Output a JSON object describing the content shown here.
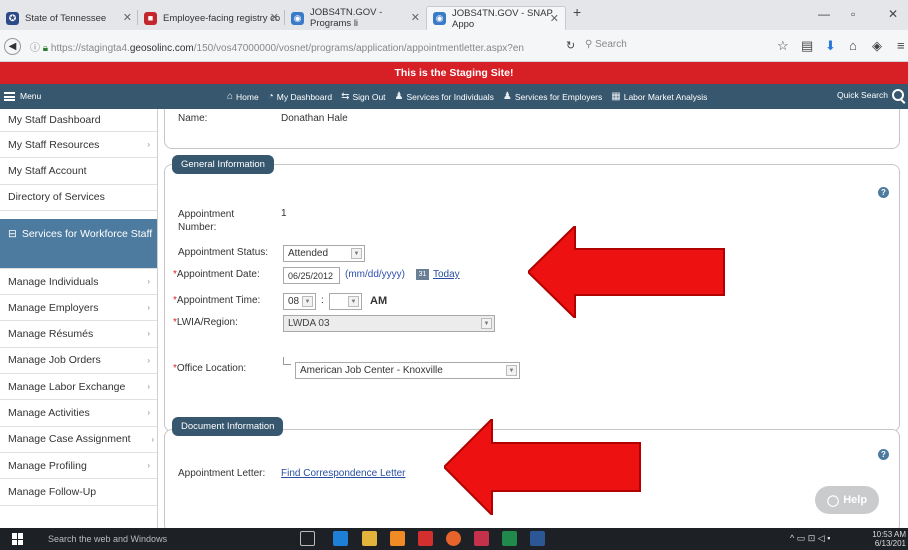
{
  "browser": {
    "tabs": [
      {
        "title": "State of Tennessee",
        "favicon_color": "#2b4b88"
      },
      {
        "title": "Employee-facing registry co",
        "favicon_color": "#c3272b"
      },
      {
        "title": "JOBS4TN.GOV - Programs li",
        "favicon_color": "#3a7bc8"
      },
      {
        "title": "JOBS4TN.GOV - SNAP Appo",
        "favicon_color": "#3a7bc8"
      }
    ],
    "url_prefix": "https://stagingta4.",
    "url_domain": "geosolinc.com",
    "url_rest": "/150/vos47000000/vosnet/programs/application/appointmentletter.aspx?en",
    "search_placeholder": "Search"
  },
  "staging_banner": "This is the Staging Site!",
  "menubar": {
    "menu_label": "Menu",
    "items": [
      "Home",
      "My Dashboard",
      "Sign Out",
      "Services for Individuals",
      "Services for Employers",
      "Labor Market Analysis"
    ],
    "quick_search": "Quick Search"
  },
  "sidebar": {
    "items_top": [
      "My Staff Dashboard",
      "My Staff Resources",
      "My Staff Account",
      "Directory of Services"
    ],
    "section": "Services for Workforce Staff",
    "items": [
      "Manage Individuals",
      "Manage Employers",
      "Manage Résumés",
      "Manage Job Orders",
      "Manage Labor Exchange",
      "Manage Activities",
      "Manage Case Assignment",
      "Manage Profiling",
      "Manage Follow-Up"
    ]
  },
  "name_row": {
    "label": "Name:",
    "value": "Donathan Hale"
  },
  "general": {
    "legend": "General Information",
    "appt_number_label": "Appointment Number:",
    "appt_number": "1",
    "status_label": "Appointment Status:",
    "status_value": "Attended",
    "date_label": "Appointment Date:",
    "date_value": "06/25/2012",
    "date_hint": "(mm/dd/yyyy)",
    "today": "Today",
    "time_label": "Appointment Time:",
    "hour": "08",
    "colon": ":",
    "ampm": "AM",
    "lwia_label": "LWIA/Region:",
    "lwia_value": "LWDA 03",
    "office_label": "Office Location:",
    "office_value": "American Job Center - Knoxville"
  },
  "document": {
    "legend": "Document Information",
    "letter_label": "Appointment Letter:",
    "letter_link": "Find Correspondence Letter"
  },
  "help_button": "Help",
  "taskbar": {
    "search": "Search the web and Windows",
    "time": "10:53 AM",
    "date": "6/13/201"
  },
  "colors": {
    "staging": "#d71f26",
    "menubar": "#37576e",
    "sidebar_highlight": "#4d7ba0",
    "arrow": "#ee1111"
  }
}
